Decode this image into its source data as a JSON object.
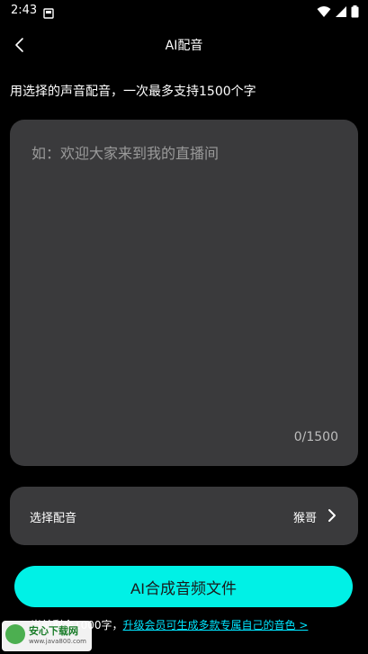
{
  "status_bar": {
    "time": "2:43"
  },
  "header": {
    "title": "AI配音"
  },
  "hint": "用选择的声音配音，一次最多支持1500个字",
  "editor": {
    "placeholder": "如：欢迎大家来到我的直播间",
    "value": "",
    "counter": "0/1500"
  },
  "voice_select": {
    "label": "选择配音",
    "value": "猴哥"
  },
  "primary_button": {
    "label": "AI合成音频文件"
  },
  "footer": {
    "remaining": "当前剩余1000字，",
    "upgrade_link": "升级会员可生成多款专属自己的音色 >"
  },
  "watermark": {
    "brand": "安心下载网",
    "url": "www.java800.com"
  },
  "colors": {
    "accent": "#00f1e6",
    "link": "#00e5ff",
    "panel": "#3a3a3c",
    "background": "#000000"
  }
}
